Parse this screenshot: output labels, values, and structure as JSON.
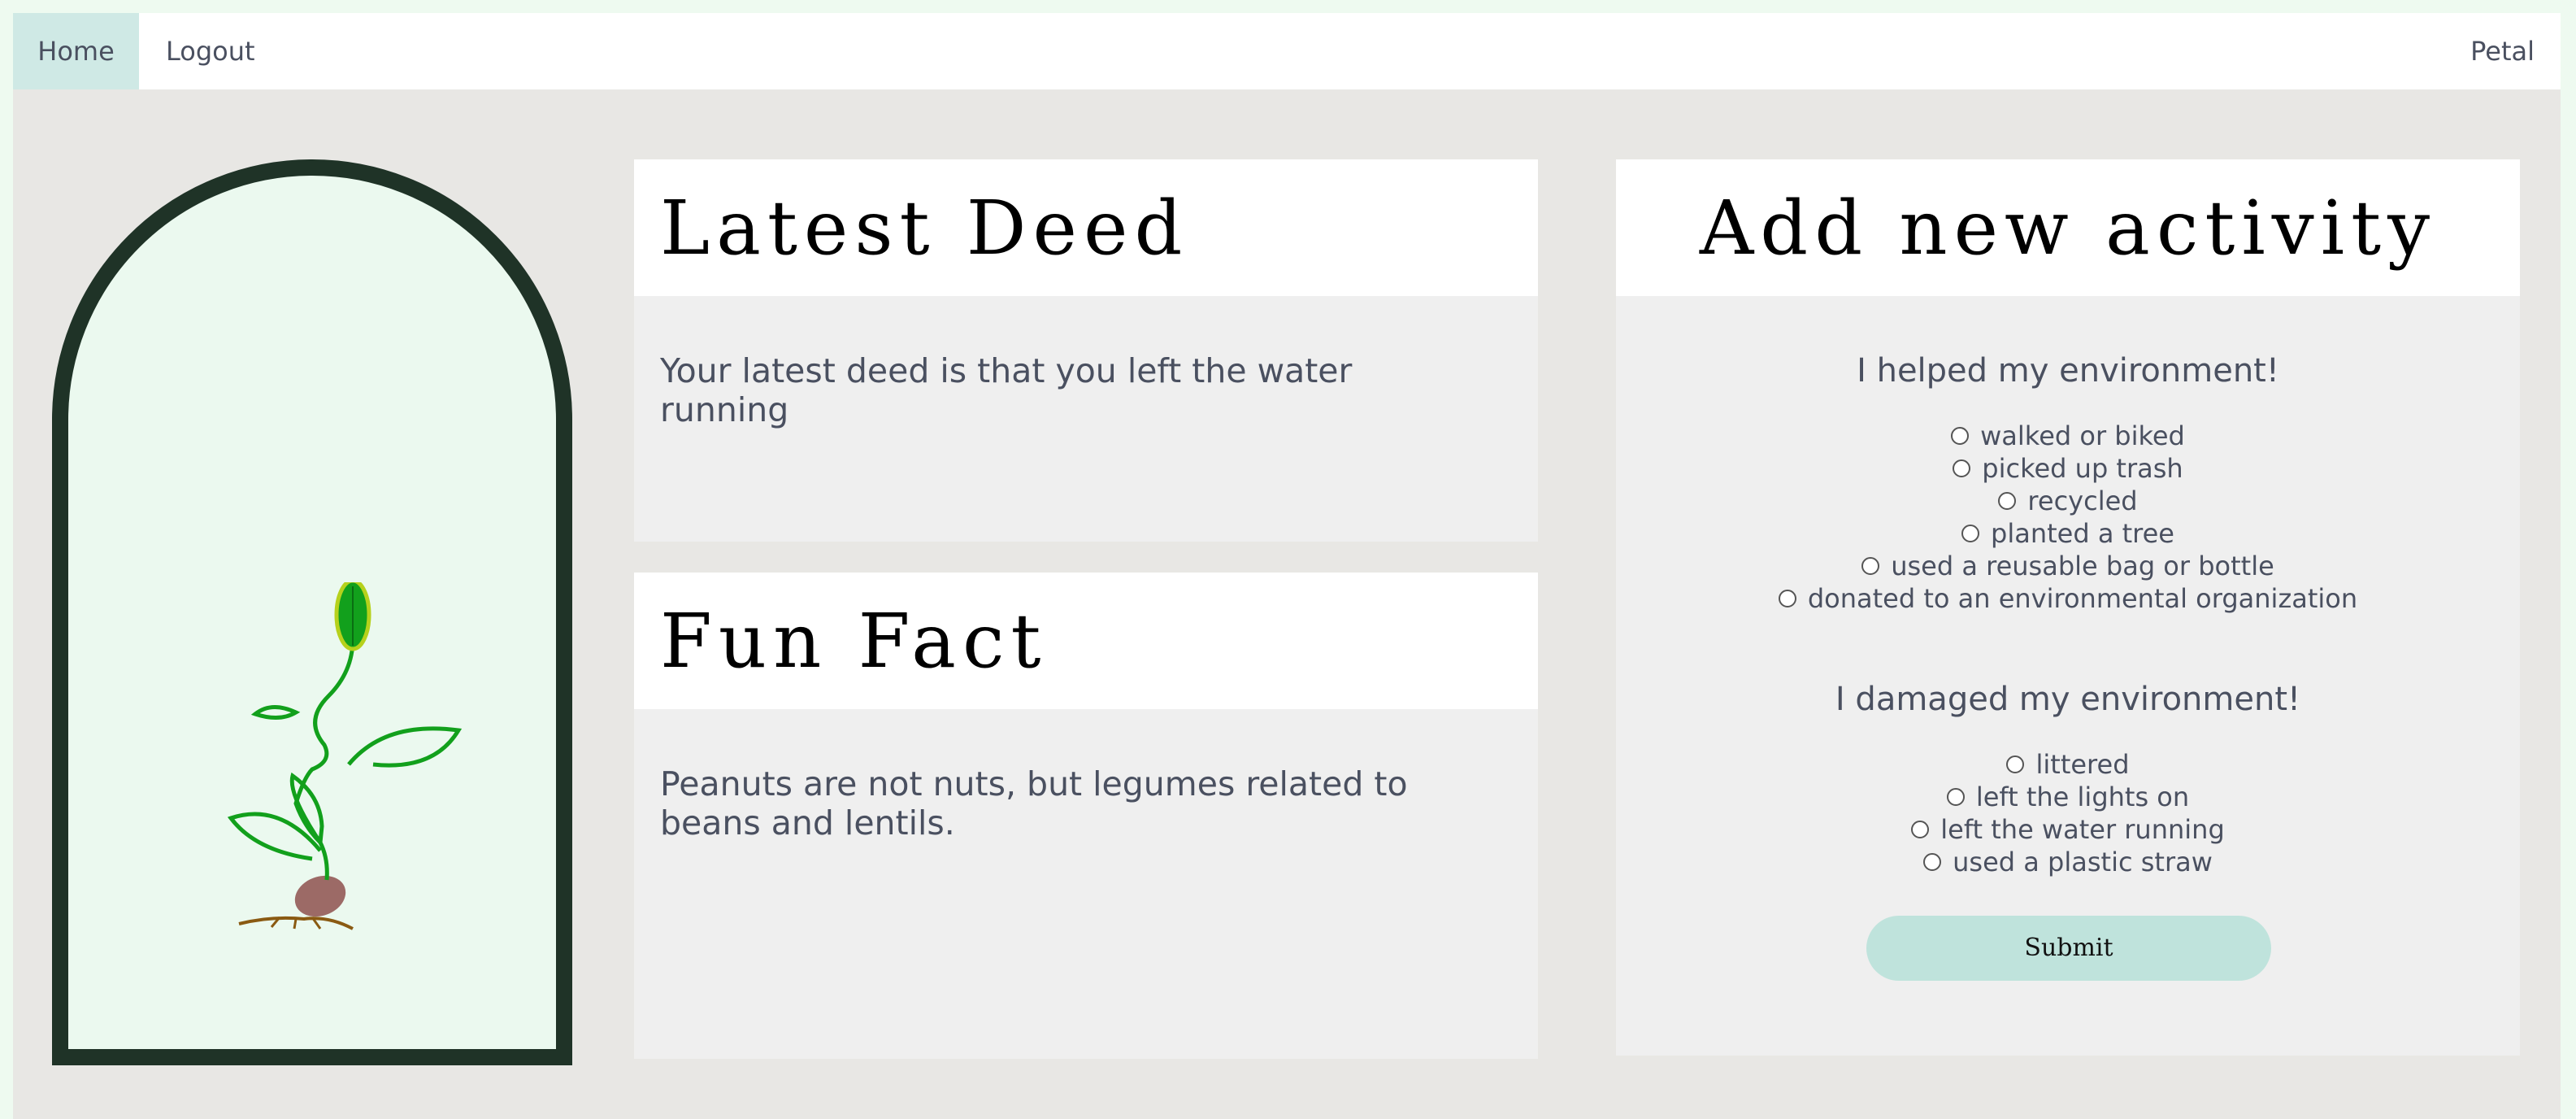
{
  "nav": {
    "home": "Home",
    "logout": "Logout",
    "brand": "Petal"
  },
  "deed": {
    "title": "Latest Deed",
    "text": "Your latest deed is that you left the water running"
  },
  "fact": {
    "title": "Fun Fact",
    "text": "Peanuts are not nuts, but legumes related to beans and lentils."
  },
  "activity": {
    "title": "Add new activity",
    "helped_title": "I helped my environment!",
    "helped_options": [
      "walked or biked",
      "picked up trash",
      "recycled",
      "planted a tree",
      "used a reusable bag or bottle",
      "donated to an environmental organization"
    ],
    "damaged_title": "I damaged my environment!",
    "damaged_options": [
      "littered",
      "left the lights on",
      "left the water running",
      "used a plastic straw"
    ],
    "submit": "Submit"
  },
  "colors": {
    "nav_active": "#cfe9e5",
    "arch_border": "#1f3327",
    "arch_fill": "#ebf9ef",
    "submit_bg": "#bfe3dc"
  }
}
